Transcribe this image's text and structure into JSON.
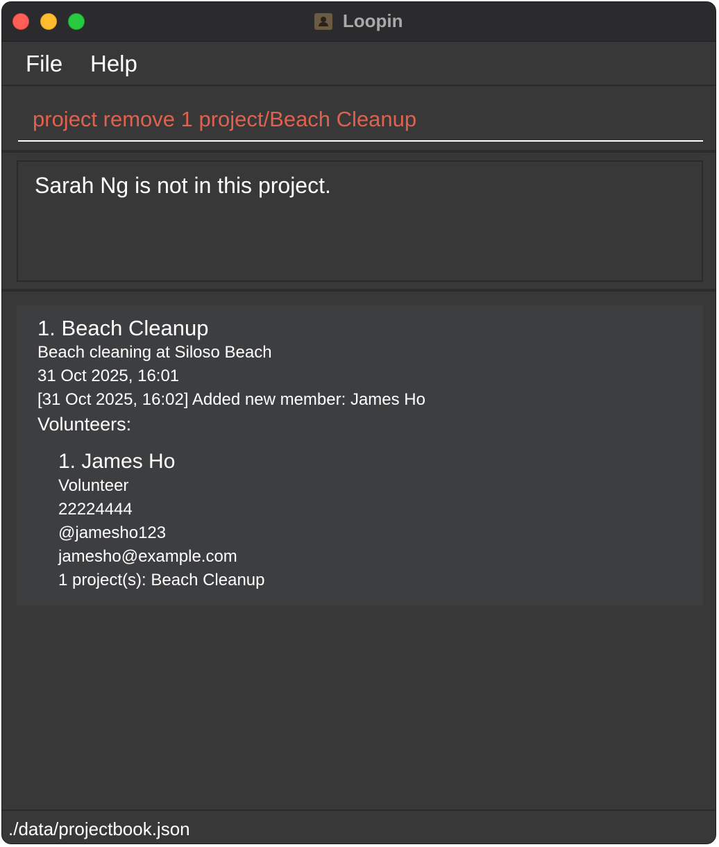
{
  "window": {
    "title": "Loopin",
    "app_icon": "contact-book-icon"
  },
  "menu": {
    "file": "File",
    "help": "Help"
  },
  "command": {
    "value": "project remove 1 project/Beach Cleanup"
  },
  "result": {
    "message": "Sarah Ng is not in this project."
  },
  "project": {
    "title": "1. Beach Cleanup",
    "description": "Beach cleaning at Siloso Beach",
    "datetime": "31 Oct 2025, 16:01",
    "log": "[31 Oct 2025, 16:02] Added new member: James Ho",
    "volunteers_label": "Volunteers:",
    "members": [
      {
        "name": "1. James Ho",
        "role": "Volunteer",
        "phone": "22224444",
        "handle": "@jamesho123",
        "email": "jamesho@example.com",
        "projects": "1 project(s): Beach Cleanup"
      }
    ]
  },
  "status": {
    "file_path": "./data/projectbook.json"
  },
  "colors": {
    "command_text": "#e0614d",
    "background": "#383838",
    "card": "#3d3e40"
  }
}
